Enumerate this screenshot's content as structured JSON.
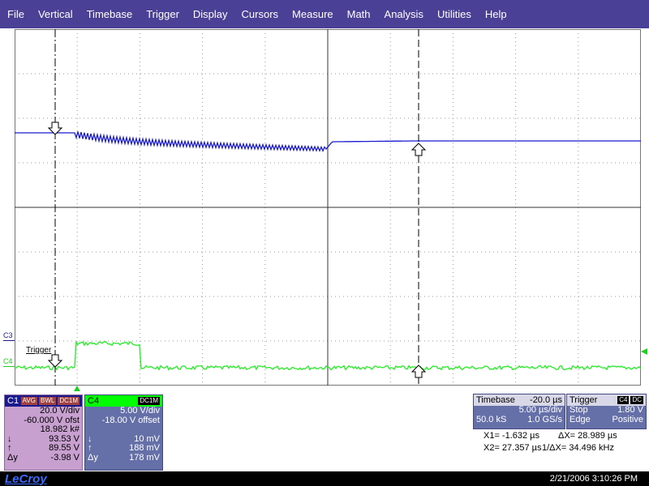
{
  "menu": [
    "File",
    "Vertical",
    "Timebase",
    "Trigger",
    "Display",
    "Cursors",
    "Measure",
    "Math",
    "Analysis",
    "Utilities",
    "Help"
  ],
  "colors": {
    "menu_bg": "#4a4196",
    "c1": "#1a1ad0",
    "c4": "#22ee22",
    "cursor": "#000000"
  },
  "markers": {
    "c3": "C3",
    "c4": "C4",
    "trigger": "Trigger"
  },
  "c1": {
    "header": "C1",
    "badges": [
      "AVG",
      "BWL",
      "DC1M"
    ],
    "volts_div": "20.0 V/div",
    "offset": "-60.000 V ofst",
    "sweeps": "18.982 k#",
    "cursor1": {
      "label": "↓",
      "value": "93.53 V"
    },
    "cursor2": {
      "label": "↑",
      "value": "89.55 V"
    },
    "delta": {
      "label": "Δy",
      "value": "-3.98 V"
    }
  },
  "c4": {
    "header": "C4",
    "badge": "DC1M",
    "volts_div": "5.00 V/div",
    "offset": "-18.00 V offset",
    "cursor1": {
      "label": "↓",
      "value": "10 mV"
    },
    "cursor2": {
      "label": "↑",
      "value": "188 mV"
    },
    "delta": {
      "label": "Δy",
      "value": "178 mV"
    }
  },
  "timebase": {
    "header": "Timebase",
    "delay": "-20.0 µs",
    "time_div": "5.00 µs/div",
    "samples": "50.0 kS",
    "rate": "1.0 GS/s"
  },
  "trigger": {
    "header": "Trigger",
    "channel": "C4",
    "coupling": "DC",
    "mode": "Stop",
    "level": "1.80 V",
    "type": "Edge",
    "slope": "Positive"
  },
  "cursors": {
    "x1": "X1= -1.632 µs",
    "dx": "ΔX=  28.989 µs",
    "x2": "X2= 27.357 µs",
    "inv_dx": "1/ΔX= 34.496 kHz"
  },
  "footer": {
    "brand": "LeCroy",
    "datetime": "2/21/2006 3:10:26 PM"
  }
}
